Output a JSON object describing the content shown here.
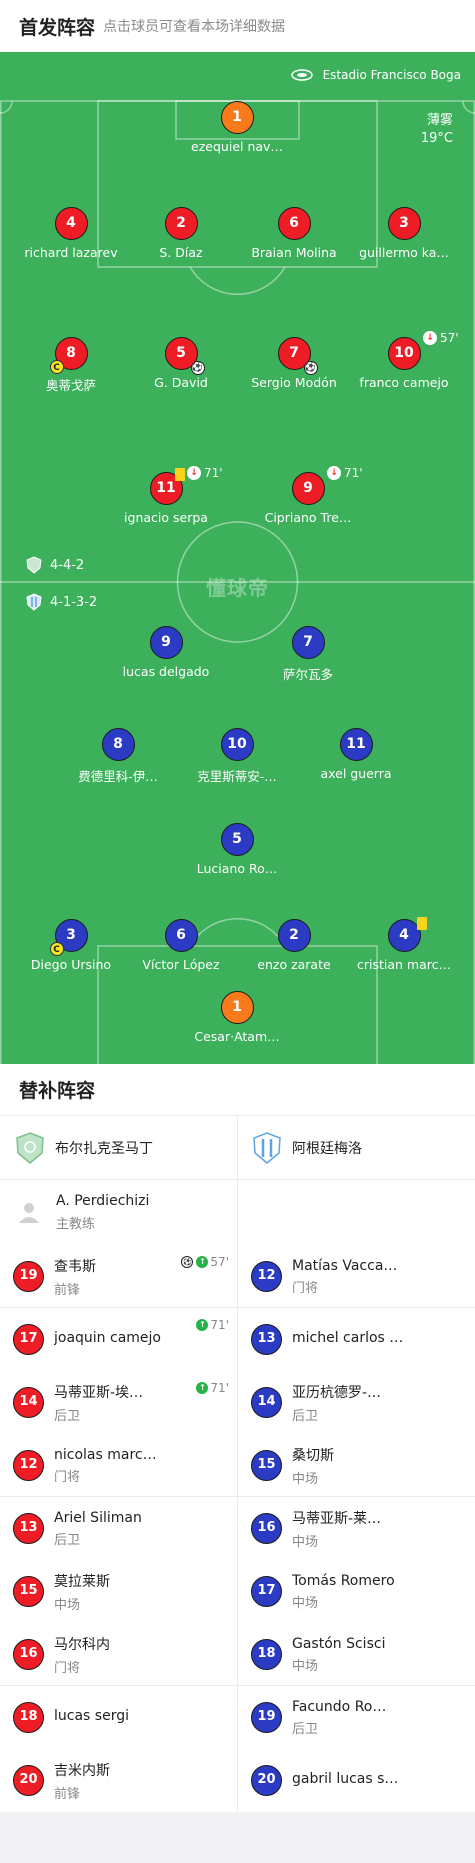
{
  "header": {
    "title": "首发阵容",
    "subtitle": "点击球员可查看本场详细数据"
  },
  "pitch": {
    "venue": "Estadio Francisco Boga",
    "weather": "薄雾",
    "temperature": "19°C",
    "watermark": "懂球帝",
    "home_formation": "4-4-2",
    "away_formation": "4-1-3-2",
    "colors": {
      "pitch": "#3cb05b",
      "home": "#ee1c25",
      "away": "#2b3bc4",
      "goalkeeper": "#f87a1a"
    }
  },
  "home_players": [
    {
      "num": "1",
      "name": "ezequiel nav…"
    },
    {
      "num": "4",
      "name": "richard lazarev"
    },
    {
      "num": "2",
      "name": "S. Díaz"
    },
    {
      "num": "6",
      "name": "Braian Molina"
    },
    {
      "num": "3",
      "name": "guillermo ka…"
    },
    {
      "num": "8",
      "name": "奥蒂戈萨"
    },
    {
      "num": "5",
      "name": "G. David"
    },
    {
      "num": "7",
      "name": "Sergio Modón"
    },
    {
      "num": "10",
      "name": "franco camejo",
      "sub_minute": "57'"
    },
    {
      "num": "11",
      "name": "ignacio serpa",
      "sub_minute": "71'"
    },
    {
      "num": "9",
      "name": "Cipriano Tre…",
      "sub_minute": "71'"
    }
  ],
  "away_players": [
    {
      "num": "9",
      "name": "lucas delgado"
    },
    {
      "num": "7",
      "name": "萨尔瓦多"
    },
    {
      "num": "8",
      "name": "费德里科-伊…"
    },
    {
      "num": "10",
      "name": "克里斯蒂安-…"
    },
    {
      "num": "11",
      "name": "axel guerra"
    },
    {
      "num": "5",
      "name": "Luciano Ro…"
    },
    {
      "num": "3",
      "name": "Diego Ursino"
    },
    {
      "num": "6",
      "name": "Víctor López"
    },
    {
      "num": "2",
      "name": "enzo zarate"
    },
    {
      "num": "4",
      "name": "cristian marc…"
    },
    {
      "num": "1",
      "name": "Cesar·Atam…"
    }
  ],
  "captain_mark": "C",
  "subs": {
    "title": "替补阵容",
    "home_team": "布尔扎克圣马丁",
    "away_team": "阿根廷梅洛",
    "coach": {
      "name": "A. Perdiechizi",
      "role": "主教练"
    },
    "home": [
      {
        "num": "19",
        "name": "查韦斯",
        "pos": "前锋",
        "minute": "57'"
      },
      {
        "num": "17",
        "name": "joaquin camejo",
        "pos": "",
        "minute": "71'"
      },
      {
        "num": "14",
        "name": "马蒂亚斯-埃…",
        "pos": "后卫",
        "minute": "71'"
      },
      {
        "num": "12",
        "name": "nicolas marc…",
        "pos": "门将"
      },
      {
        "num": "13",
        "name": "Ariel Siliman",
        "pos": "后卫"
      },
      {
        "num": "15",
        "name": "莫拉莱斯",
        "pos": "中场"
      },
      {
        "num": "16",
        "name": "马尔科内",
        "pos": "门将"
      },
      {
        "num": "18",
        "name": "lucas sergi",
        "pos": ""
      },
      {
        "num": "20",
        "name": "吉米内斯",
        "pos": "前锋"
      }
    ],
    "away": [
      {
        "num": "12",
        "name": "Matías Vacca…",
        "pos": "门将"
      },
      {
        "num": "13",
        "name": "michel carlos …",
        "pos": ""
      },
      {
        "num": "14",
        "name": "亚历杭德罗-…",
        "pos": "后卫"
      },
      {
        "num": "15",
        "name": "桑切斯",
        "pos": "中场"
      },
      {
        "num": "16",
        "name": "马蒂亚斯-莱…",
        "pos": "中场"
      },
      {
        "num": "17",
        "name": "Tomás Romero",
        "pos": "中场"
      },
      {
        "num": "18",
        "name": "Gastón Scisci",
        "pos": "中场"
      },
      {
        "num": "19",
        "name": "Facundo Ro…",
        "pos": "后卫"
      },
      {
        "num": "20",
        "name": "gabril lucas s…",
        "pos": ""
      }
    ]
  }
}
